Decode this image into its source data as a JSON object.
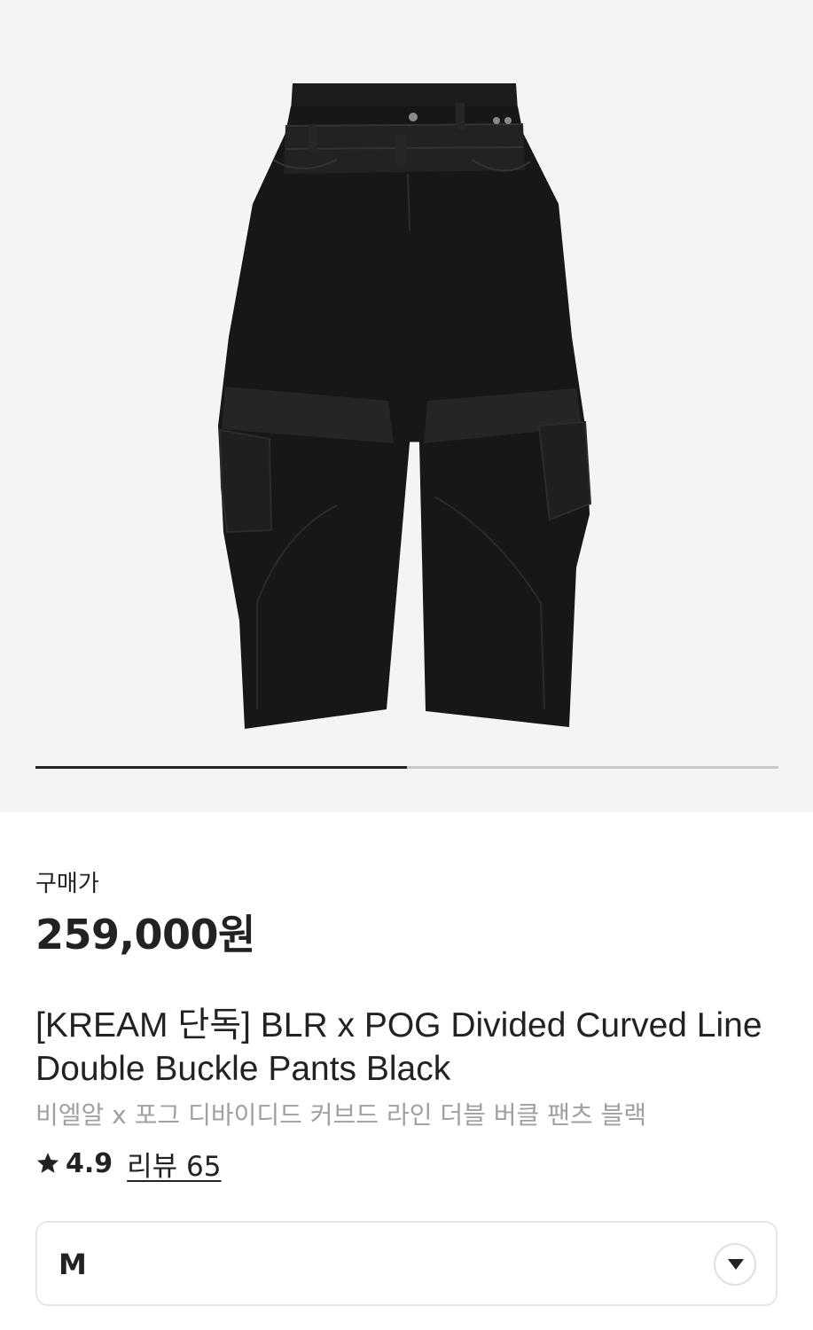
{
  "gallery": {
    "image_alt": "BLR x POG Divided Curved Line Double Buckle Pants Black",
    "progress_fraction": 0.5
  },
  "price": {
    "label": "구매가",
    "amount": "259,000원"
  },
  "product": {
    "title": "[KREAM 단독] BLR x POG Divided Curved Line Double Buckle Pants Black",
    "subtitle": "비엘알 x 포그 디바이디드 커브드 라인 더블 버클 팬츠 블랙"
  },
  "rating": {
    "icon": "star-icon",
    "value": "4.9",
    "review_label": "리뷰 65"
  },
  "size_select": {
    "selected": "M",
    "icon": "chevron-down-icon"
  }
}
